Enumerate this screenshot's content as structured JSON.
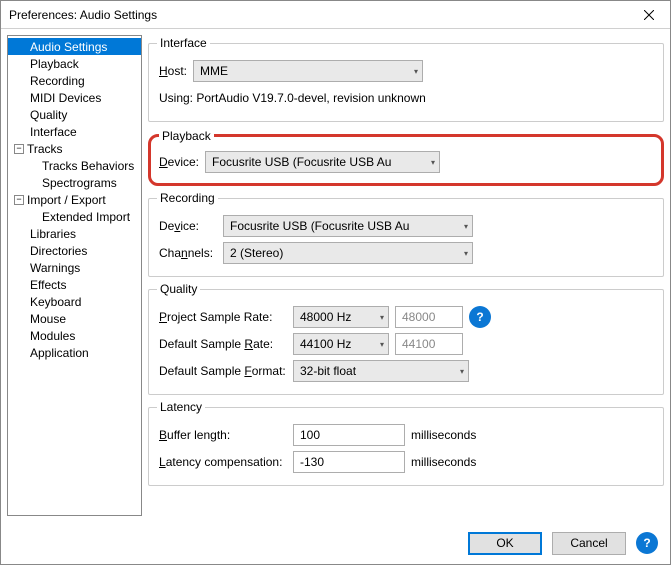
{
  "window": {
    "title": "Preferences: Audio Settings",
    "close_icon": "close"
  },
  "tree": {
    "items": [
      {
        "label": "Audio Settings",
        "selected": true,
        "level": "top"
      },
      {
        "label": "Playback",
        "level": "top"
      },
      {
        "label": "Recording",
        "level": "top"
      },
      {
        "label": "MIDI Devices",
        "level": "top"
      },
      {
        "label": "Quality",
        "level": "top"
      },
      {
        "label": "Interface",
        "level": "top"
      },
      {
        "label": "Tracks",
        "level": "expand",
        "toggle": "−"
      },
      {
        "label": "Tracks Behaviors",
        "level": "child"
      },
      {
        "label": "Spectrograms",
        "level": "child"
      },
      {
        "label": "Import / Export",
        "level": "expand",
        "toggle": "−"
      },
      {
        "label": "Extended Import",
        "level": "child"
      },
      {
        "label": "Libraries",
        "level": "top"
      },
      {
        "label": "Directories",
        "level": "top"
      },
      {
        "label": "Warnings",
        "level": "top"
      },
      {
        "label": "Effects",
        "level": "top"
      },
      {
        "label": "Keyboard",
        "level": "top"
      },
      {
        "label": "Mouse",
        "level": "top"
      },
      {
        "label": "Modules",
        "level": "top"
      },
      {
        "label": "Application",
        "level": "top"
      }
    ]
  },
  "interface": {
    "group_label": "Interface",
    "host_label": "Host:",
    "host_value": "MME",
    "using_text": "Using: PortAudio V19.7.0-devel, revision unknown"
  },
  "playback": {
    "group_label": "Playback",
    "device_label": "Device:",
    "device_value": "Focusrite USB (Focusrite USB Au"
  },
  "recording": {
    "group_label": "Recording",
    "device_label": "Device:",
    "device_value": "Focusrite USB (Focusrite USB Au",
    "channels_label": "Channels:",
    "channels_value": "2 (Stereo)"
  },
  "quality": {
    "group_label": "Quality",
    "project_rate_label": "Project Sample Rate:",
    "project_rate_value": "48000 Hz",
    "project_rate_custom": "48000",
    "default_rate_label": "Default Sample Rate:",
    "default_rate_value": "44100 Hz",
    "default_rate_custom": "44100",
    "format_label": "Default Sample Format:",
    "format_value": "32-bit float",
    "help_icon": "?"
  },
  "latency": {
    "group_label": "Latency",
    "buffer_label": "Buffer length:",
    "buffer_value": "100",
    "buffer_unit": "milliseconds",
    "comp_label": "Latency compensation:",
    "comp_value": "-130",
    "comp_unit": "milliseconds"
  },
  "buttons": {
    "ok": "OK",
    "cancel": "Cancel",
    "help_icon": "?"
  }
}
